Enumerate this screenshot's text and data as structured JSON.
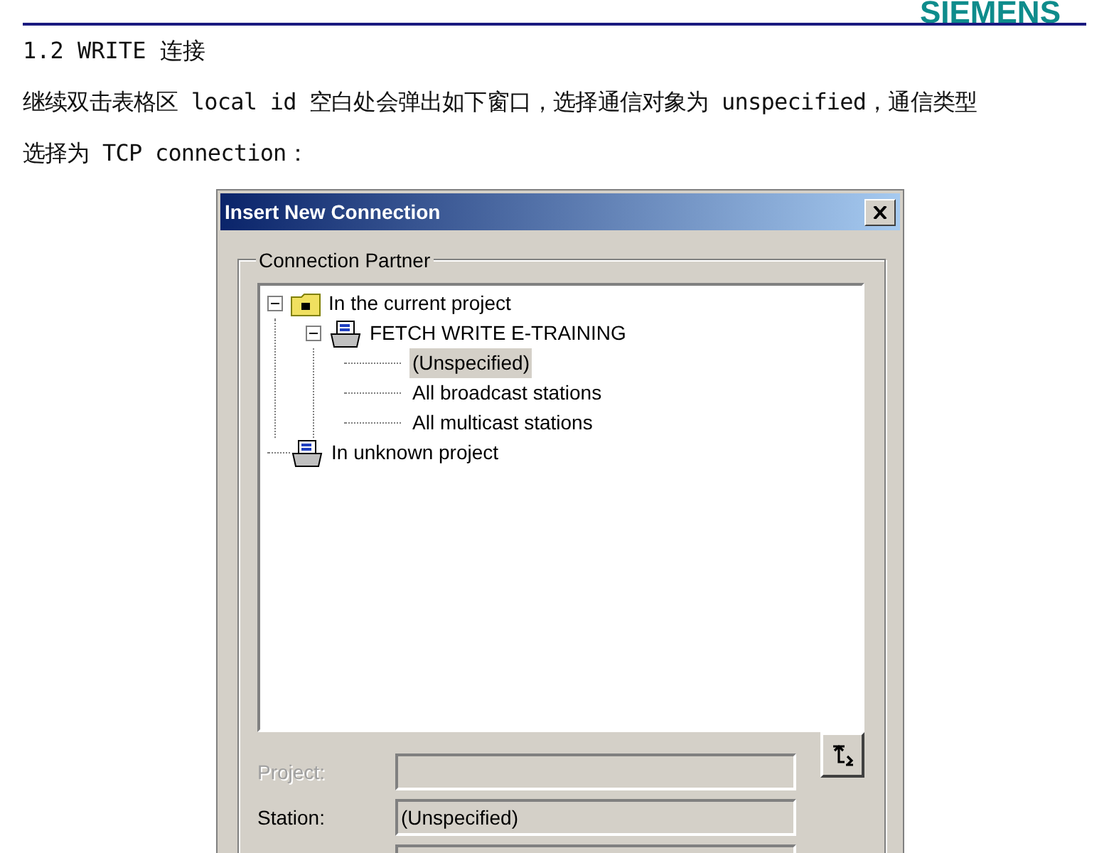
{
  "header": {
    "logo": "SIEMENS"
  },
  "heading": "1.2 WRITE 连接",
  "paragraph": [
    "继续双击表格区 local id 空白处会弹出如下窗口，选择通信对象为 unspecified，通信类型",
    "选择为 TCP connection："
  ],
  "dialog": {
    "title": "Insert New Connection",
    "group_label": "Connection Partner",
    "tree": [
      {
        "label": "In the current project",
        "kind": "folder",
        "expanded": true,
        "selected": false,
        "children": [
          {
            "label": "FETCH WRITE E-TRAINING",
            "kind": "station",
            "expanded": true,
            "selected": false,
            "children": [
              {
                "label": "(Unspecified)",
                "kind": "leaf",
                "selected": true
              },
              {
                "label": "All broadcast stations",
                "kind": "leaf",
                "selected": false
              },
              {
                "label": "All multicast stations",
                "kind": "leaf",
                "selected": false
              }
            ]
          }
        ]
      },
      {
        "label": "In unknown project",
        "kind": "station",
        "selected": false
      }
    ],
    "fields": [
      {
        "kind": "text",
        "label": "Project:",
        "disabled": true
      },
      {
        "kind": "text",
        "label": "Station:",
        "value": "(Unspecified)",
        "disabled": false
      },
      {
        "kind": "text"
      }
    ]
  }
}
